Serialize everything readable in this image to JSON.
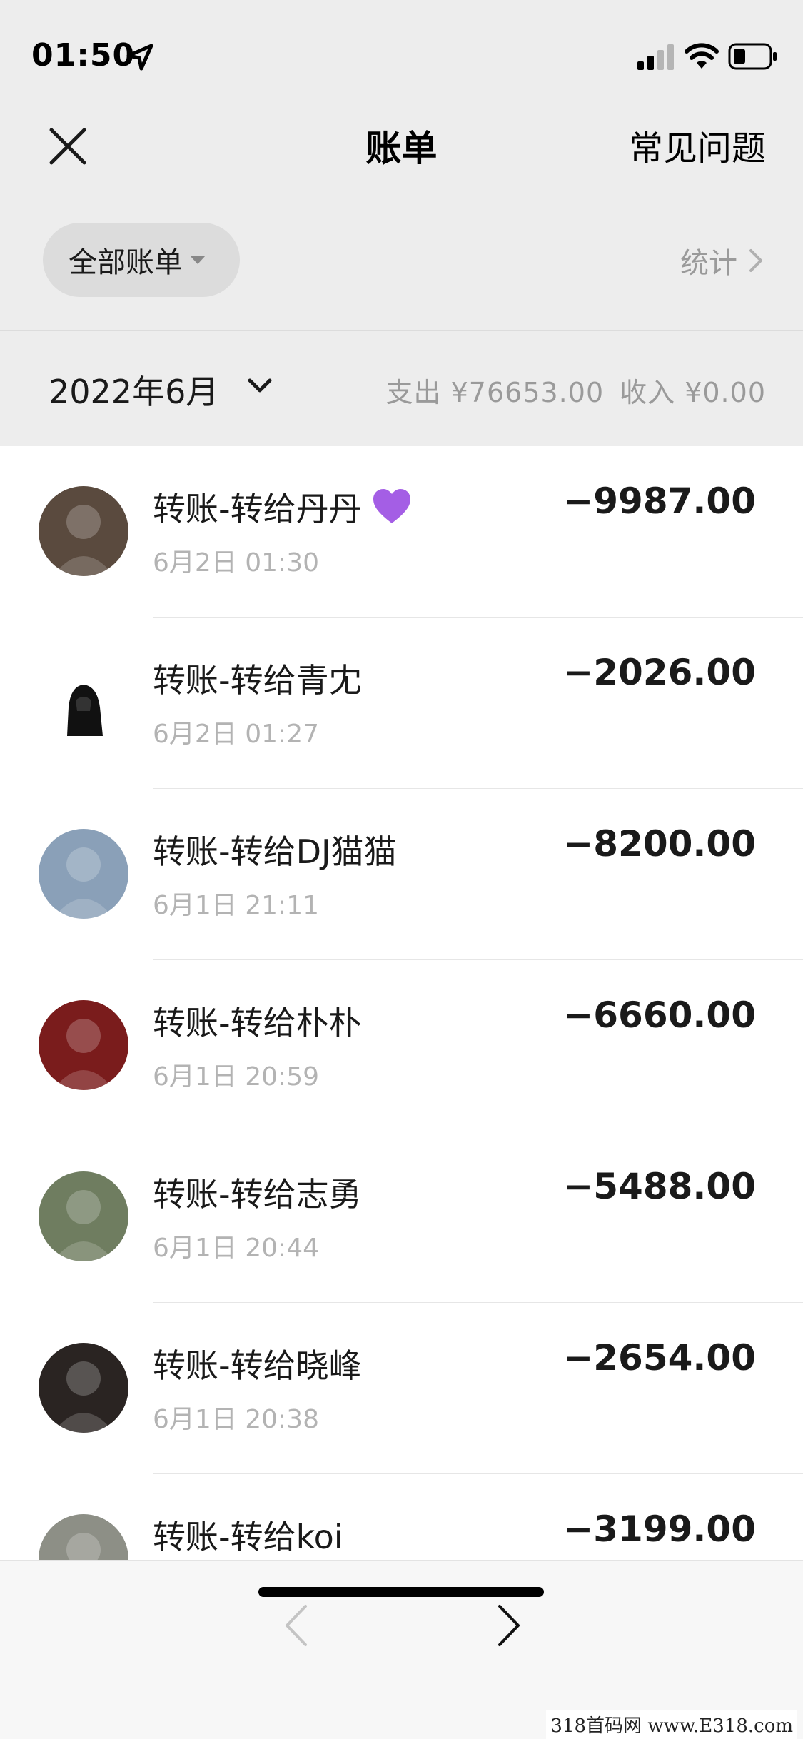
{
  "status_bar": {
    "time": "01:50",
    "icons": [
      "location-arrow-icon",
      "signal-icon",
      "wifi-icon",
      "battery-icon"
    ]
  },
  "nav": {
    "title": "账单",
    "right_link": "常见问题",
    "left_icon": "close-icon"
  },
  "filter": {
    "selected": "全部账单",
    "stats_label": "统计"
  },
  "month": {
    "label": "2022年6月",
    "expense": "支出 ¥76653.00",
    "income": "收入 ¥0.00"
  },
  "bills": [
    {
      "title": "转账-转给丹丹",
      "emoji": "purple-heart-icon",
      "time": "6月2日 01:30",
      "amount": "−9987.00",
      "avatar_color": "#5a4a3e"
    },
    {
      "title": "转账-转给青冘",
      "time": "6月2日 01:27",
      "amount": "−2026.00",
      "avatar_color": "#ffffff"
    },
    {
      "title": "转账-转给DJ猫猫",
      "time": "6月1日 21:11",
      "amount": "−8200.00",
      "avatar_color": "#8aa0b8"
    },
    {
      "title": "转账-转给朴朴",
      "time": "6月1日 20:59",
      "amount": "−6660.00",
      "avatar_color": "#7a1c1c"
    },
    {
      "title": "转账-转给志勇",
      "time": "6月1日 20:44",
      "amount": "−5488.00",
      "avatar_color": "#6f7d60"
    },
    {
      "title": "转账-转给晓峰",
      "time": "6月1日 20:38",
      "amount": "−2654.00",
      "avatar_color": "#2a2422"
    },
    {
      "title": "转账-转给koi",
      "time": "",
      "amount": "−3199.00",
      "avatar_color": "#8d8f86"
    }
  ],
  "toolbar": {
    "back_icon": "chevron-left-icon",
    "forward_icon": "chevron-right-icon"
  },
  "watermark": "318首码网 www.E318.com",
  "colors": {
    "header_bg": "#ededed",
    "muted_text": "#9a9a9a",
    "heart": "#a45ee5"
  }
}
